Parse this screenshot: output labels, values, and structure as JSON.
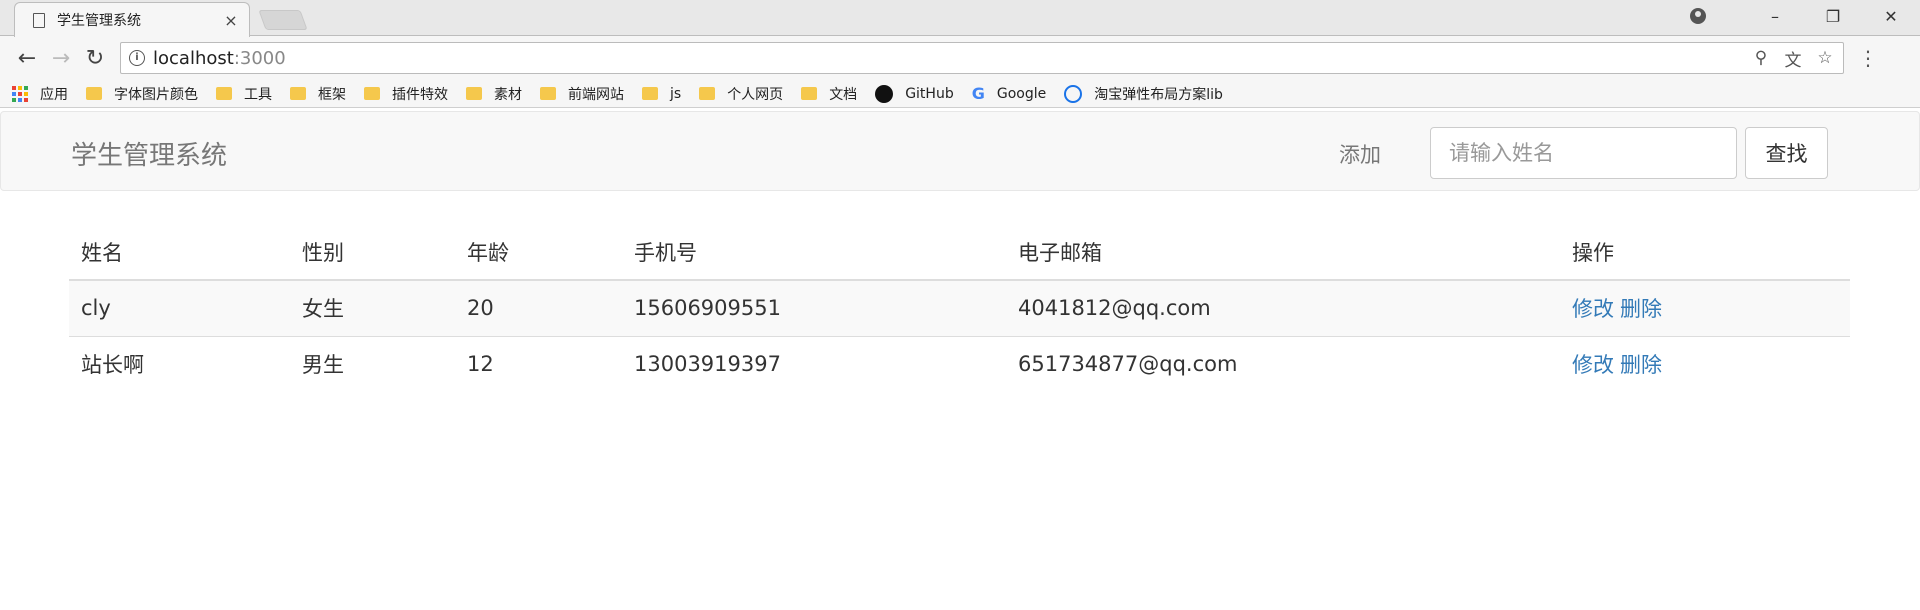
{
  "browser": {
    "tab_title": "学生管理系统",
    "tab_close": "×",
    "address_host": "localhost",
    "address_port": ":3000",
    "bookmarks": [
      {
        "label": "应用",
        "icon": "apps-icon"
      },
      {
        "label": "字体图片颜色",
        "icon": "folder-icon"
      },
      {
        "label": "工具",
        "icon": "folder-icon"
      },
      {
        "label": "框架",
        "icon": "folder-icon"
      },
      {
        "label": "插件特效",
        "icon": "folder-icon"
      },
      {
        "label": "素材",
        "icon": "folder-icon"
      },
      {
        "label": "前端网站",
        "icon": "folder-icon"
      },
      {
        "label": "js",
        "icon": "folder-icon"
      },
      {
        "label": "个人网页",
        "icon": "folder-icon"
      },
      {
        "label": "文档",
        "icon": "folder-icon"
      },
      {
        "label": "GitHub",
        "icon": "github-icon"
      },
      {
        "label": "Google",
        "icon": "google-icon"
      },
      {
        "label": "淘宝弹性布局方案lib",
        "icon": "taobao-icon"
      }
    ]
  },
  "navbar": {
    "brand": "学生管理系统",
    "add_label": "添加",
    "search_placeholder": "请输入姓名",
    "search_button": "查找"
  },
  "table": {
    "headers": [
      "姓名",
      "性别",
      "年龄",
      "手机号",
      "电子邮箱",
      "操作"
    ],
    "rows": [
      {
        "name": "cly",
        "gender": "女生",
        "age": "20",
        "phone": "15606909551",
        "email": "4041812@qq.com",
        "edit": "修改",
        "delete": "删除"
      },
      {
        "name": "站长啊",
        "gender": "男生",
        "age": "12",
        "phone": "13003919397",
        "email": "651734877@qq.com",
        "edit": "修改",
        "delete": "删除"
      }
    ]
  },
  "colors": {
    "link": "#337ab7",
    "navbar_bg": "#f8f8f8",
    "folder": "#f5c84c"
  }
}
